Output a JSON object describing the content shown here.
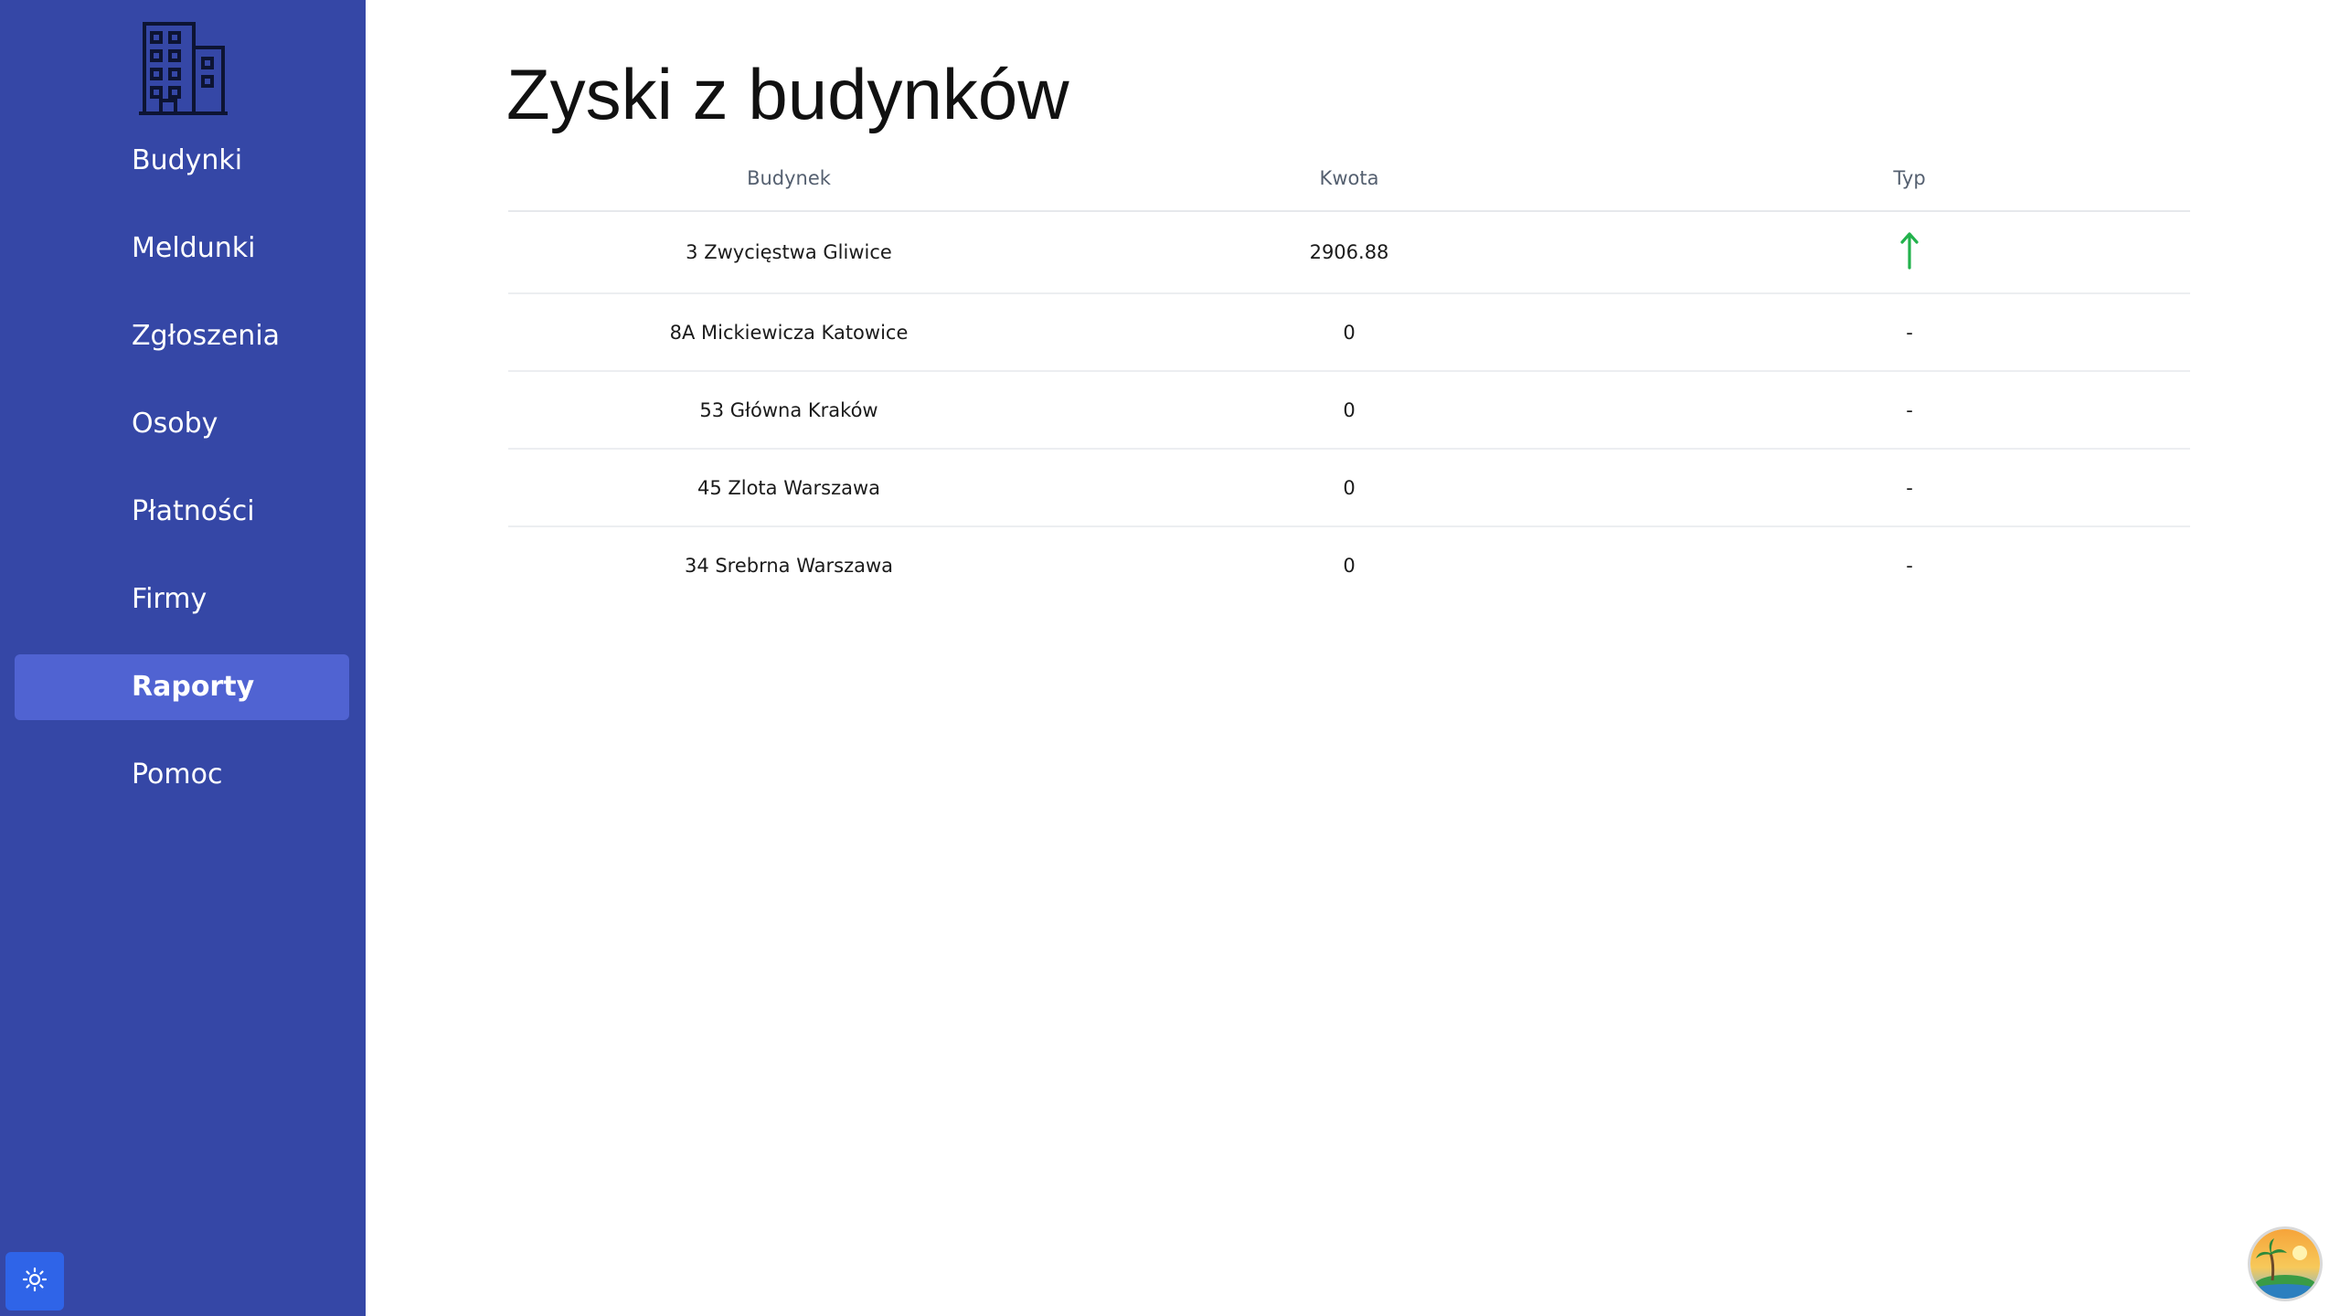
{
  "sidebar": {
    "logo_icon": "building-icon",
    "items": [
      {
        "label": "Budynki"
      },
      {
        "label": "Meldunki"
      },
      {
        "label": "Zgłoszenia"
      },
      {
        "label": "Osoby"
      },
      {
        "label": "Płatności"
      },
      {
        "label": "Firmy"
      },
      {
        "label": "Raporty",
        "active": true
      },
      {
        "label": "Pomoc"
      }
    ],
    "theme_toggle_icon": "sun-icon"
  },
  "main": {
    "title": "Zyski z budynków",
    "table": {
      "headers": [
        "Budynek",
        "Kwota",
        "Typ"
      ],
      "rows": [
        {
          "building": "3 Zwycięstwa Gliwice",
          "amount": "2906.88",
          "type": "arrow-up-icon"
        },
        {
          "building": "8A Mickiewicza Katowice",
          "amount": "0",
          "type": "-"
        },
        {
          "building": "53 Główna Kraków",
          "amount": "0",
          "type": "-"
        },
        {
          "building": "45 Zlota Warszawa",
          "amount": "0",
          "type": "-"
        },
        {
          "building": "34 Srebrna Warszawa",
          "amount": "0",
          "type": "-"
        }
      ]
    }
  },
  "avatar_icon": "user-avatar-icon",
  "colors": {
    "sidebar_bg": "#3547a6",
    "active_item_bg": "#5063d2",
    "profit_arrow": "#22b24c",
    "theme_button": "#2f64e8"
  }
}
